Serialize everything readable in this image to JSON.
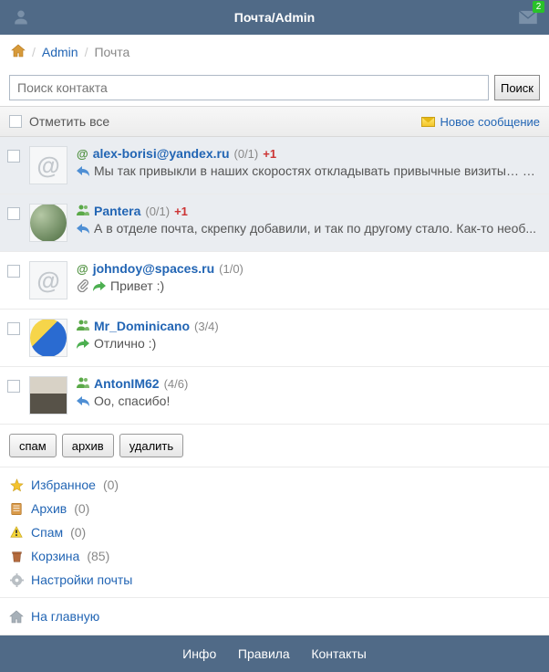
{
  "header": {
    "title": "Почта/Admin",
    "unread_badge": "2"
  },
  "breadcrumb": {
    "admin": "Admin",
    "current": "Почта"
  },
  "search": {
    "placeholder": "Поиск контакта",
    "button": "Поиск"
  },
  "selectall": {
    "label": "Отметить все",
    "new_msg": "Новое сообщение"
  },
  "messages": [
    {
      "sender": "alex-borisi@yandex.ru",
      "counts": "(0/1)",
      "plus": "+1",
      "preview": "Мы так привыкли в наших скоростях откладывать привычные визиты…  М...",
      "unread": true,
      "icon": "at",
      "avatar": "at",
      "reply": true
    },
    {
      "sender": "Pantera",
      "counts": "(0/1)",
      "plus": "+1",
      "preview": "А в отделе почта, скрепку добавили, и так по другому стало. Как-то необ...",
      "unread": true,
      "icon": "users",
      "avatar": "pantera",
      "reply": true
    },
    {
      "sender": "johndoy@spaces.ru",
      "counts": "(1/0)",
      "plus": "",
      "preview": "Привет :)",
      "unread": false,
      "icon": "at",
      "avatar": "at",
      "clip": true,
      "fwd": true
    },
    {
      "sender": "Mr_Dominicano",
      "counts": "(3/4)",
      "plus": "",
      "preview": "Отлично :)",
      "unread": false,
      "icon": "users",
      "avatar": "domin",
      "fwd": true
    },
    {
      "sender": "AntonIM62",
      "counts": "(4/6)",
      "plus": "",
      "preview": "Оо, спасибо!",
      "unread": false,
      "icon": "users",
      "avatar": "anton",
      "reply": true
    }
  ],
  "actions": {
    "spam": "спам",
    "archive": "архив",
    "delete": "удалить"
  },
  "folders": [
    {
      "label": "Избранное",
      "count": "(0)",
      "icon": "star"
    },
    {
      "label": "Архив",
      "count": "(0)",
      "icon": "archive"
    },
    {
      "label": "Спам",
      "count": "(0)",
      "icon": "spam"
    },
    {
      "label": "Корзина",
      "count": "(85)",
      "icon": "trash"
    },
    {
      "label": "Настройки почты",
      "count": "",
      "icon": "gear"
    }
  ],
  "mainlink": "На главную",
  "footer": {
    "info": "Инфо",
    "rules": "Правила",
    "contacts": "Контакты"
  }
}
